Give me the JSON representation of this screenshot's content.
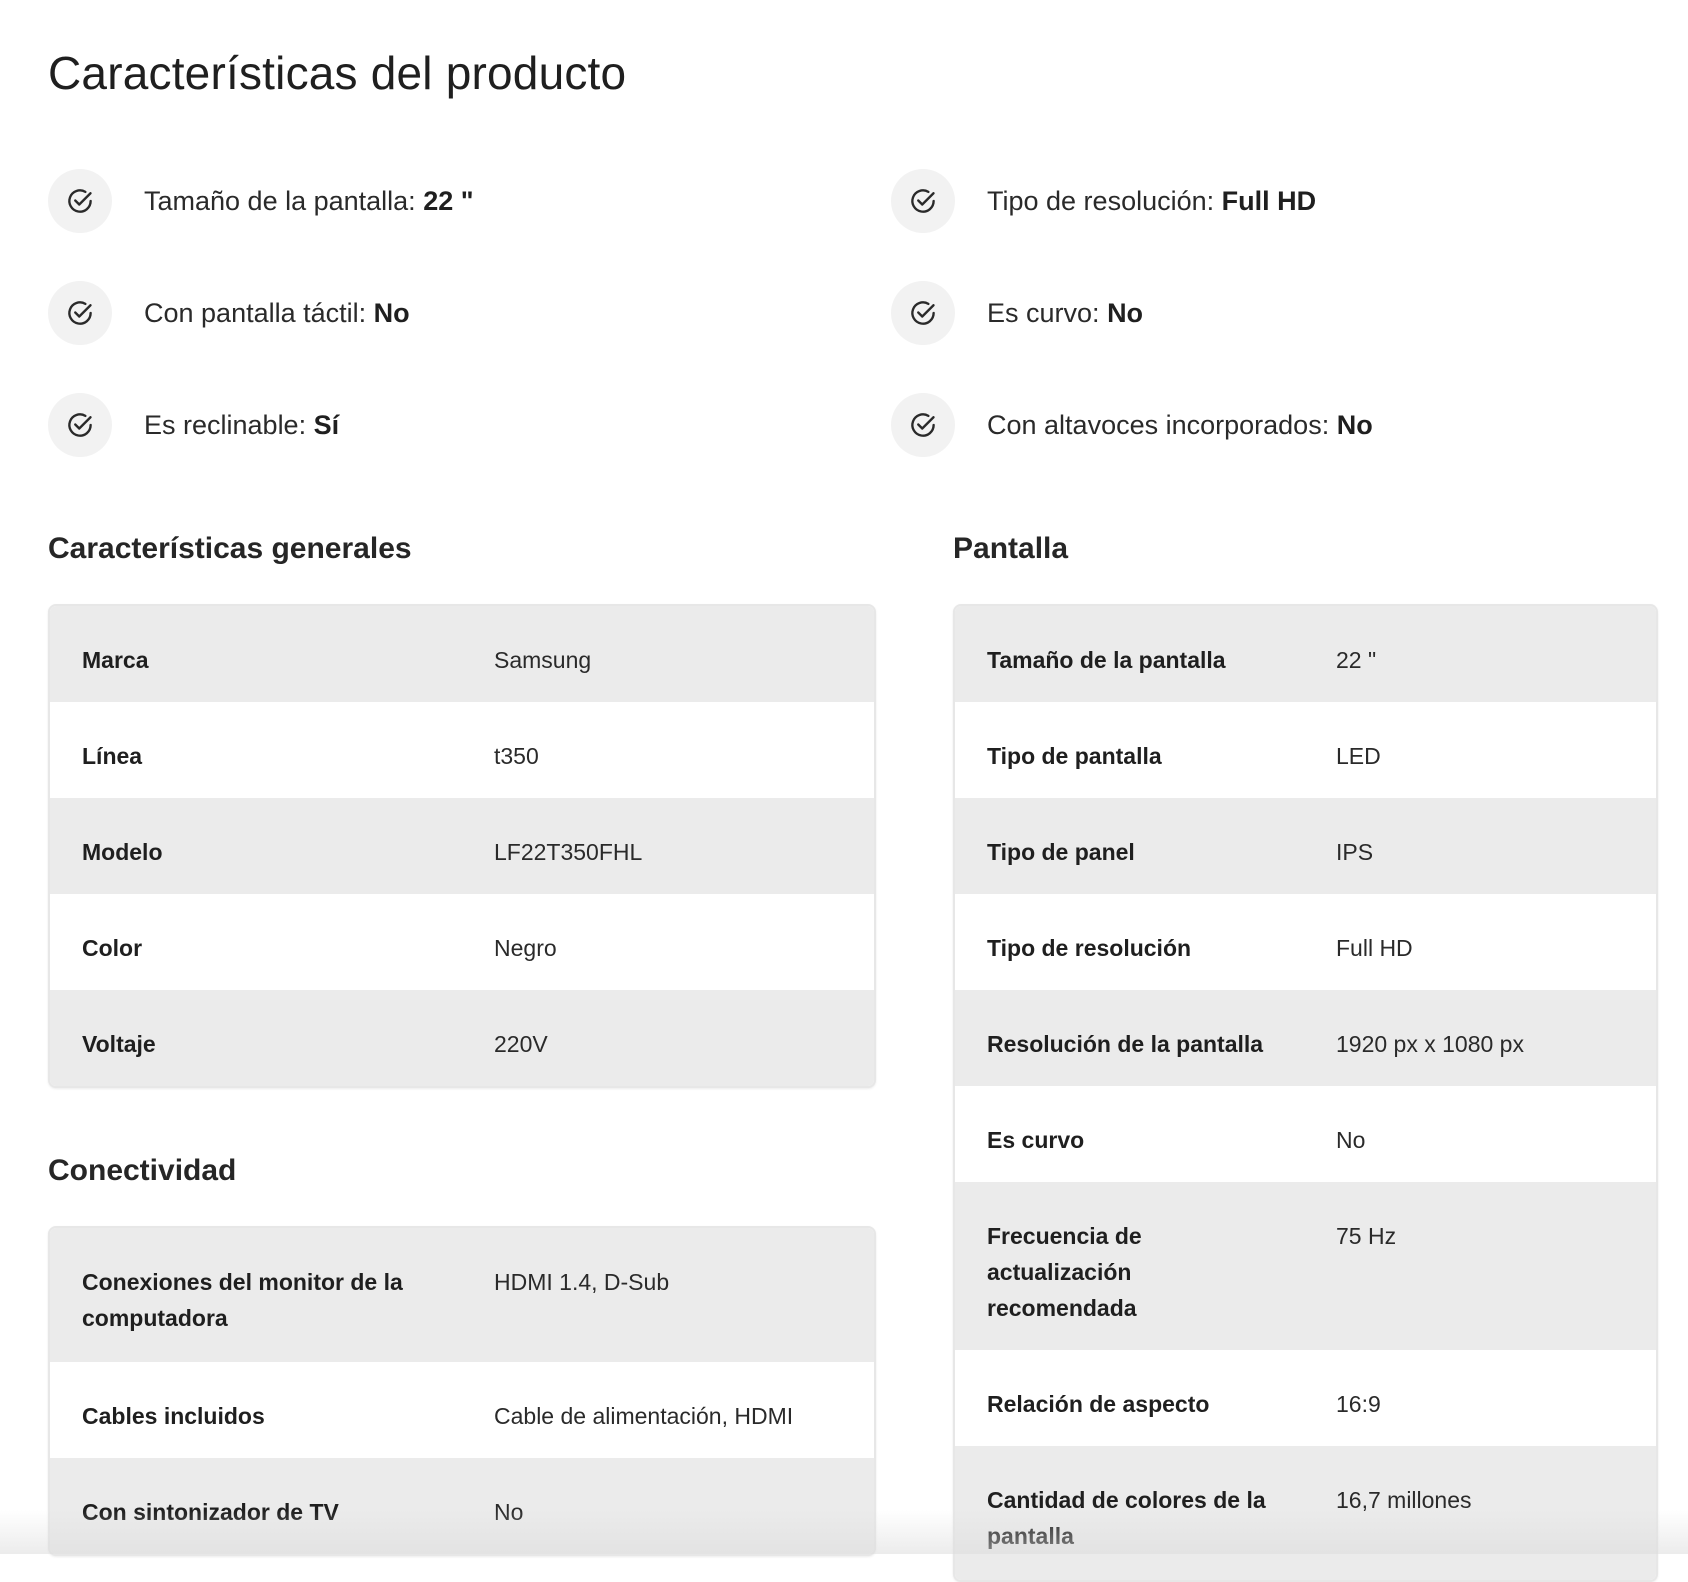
{
  "page": {
    "title": "Características del producto"
  },
  "highlights": [
    {
      "label": "Tamaño de la pantalla:",
      "value": "22 \""
    },
    {
      "label": "Tipo de resolución:",
      "value": "Full HD"
    },
    {
      "label": "Con pantalla táctil:",
      "value": "No"
    },
    {
      "label": "Es curvo:",
      "value": "No"
    },
    {
      "label": "Es reclinable:",
      "value": "Sí"
    },
    {
      "label": "Con altavoces incorporados:",
      "value": "No"
    }
  ],
  "general": {
    "title": "Características generales",
    "rows": [
      {
        "label": "Marca",
        "value": "Samsung"
      },
      {
        "label": "Línea",
        "value": "t350"
      },
      {
        "label": "Modelo",
        "value": "LF22T350FHL"
      },
      {
        "label": "Color",
        "value": "Negro"
      },
      {
        "label": "Voltaje",
        "value": "220V"
      }
    ]
  },
  "conectividad": {
    "title": "Conectividad",
    "rows": [
      {
        "label": "Conexiones del monitor de la computadora",
        "value": "HDMI 1.4, D-Sub"
      },
      {
        "label": "Cables incluidos",
        "value": "Cable de alimentación, HDMI"
      },
      {
        "label": "Con sintonizador de TV",
        "value": "No"
      }
    ]
  },
  "pantalla": {
    "title": "Pantalla",
    "rows": [
      {
        "label": "Tamaño de la pantalla",
        "value": "22 \""
      },
      {
        "label": "Tipo de pantalla",
        "value": "LED"
      },
      {
        "label": "Tipo de panel",
        "value": "IPS"
      },
      {
        "label": "Tipo de resolución",
        "value": "Full HD"
      },
      {
        "label": "Resolución de la pantalla",
        "value": "1920 px x 1080 px"
      },
      {
        "label": "Es curvo",
        "value": "No"
      },
      {
        "label": "Frecuencia de actualización recomendada",
        "value": "75 Hz"
      },
      {
        "label": "Relación de aspecto",
        "value": "16:9"
      },
      {
        "label": "Cantidad de colores de la pantalla",
        "value": "16,7 millones"
      }
    ]
  },
  "colors": {
    "row_shaded": "#ebebeb",
    "row_plain": "#ffffff",
    "icon_bg": "#f2f2f2",
    "text": "#1f1f1f"
  },
  "icons": {
    "highlight": "check-circle-icon"
  }
}
